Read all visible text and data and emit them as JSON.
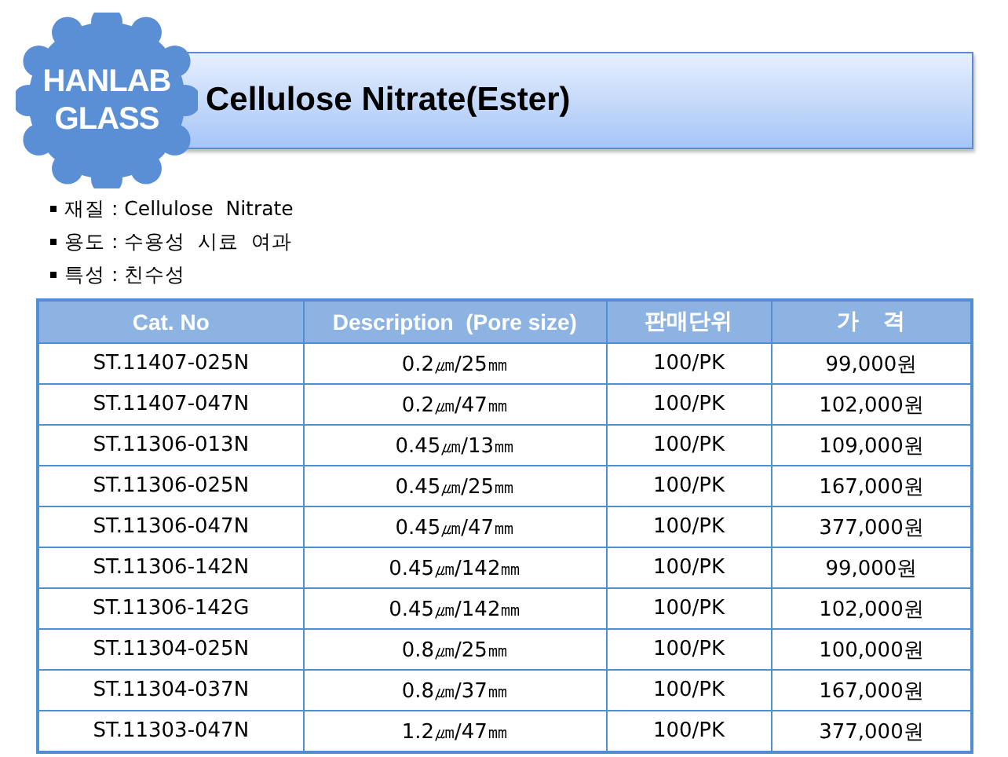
{
  "badge": {
    "lines": [
      "HANLAB",
      "GLASS"
    ]
  },
  "title": "Cellulose Nitrate(Ester)",
  "specs": [
    {
      "text": "재질 : Cellulose  Nitrate"
    },
    {
      "text": "용도 : 수용성  시료  여과"
    },
    {
      "text": "특성 : 친수성"
    }
  ],
  "table": {
    "columns": [
      "Cat. No",
      "Description  (Pore size)",
      "판매단위",
      "가    격"
    ],
    "rows": [
      [
        "ST.11407-025N",
        "0.2㎛/25㎜",
        "100/PK",
        "99,000원"
      ],
      [
        "ST.11407-047N",
        "0.2㎛/47㎜",
        "100/PK",
        "102,000원"
      ],
      [
        "ST.11306-013N",
        "0.45㎛/13㎜",
        "100/PK",
        "109,000원"
      ],
      [
        "ST.11306-025N",
        "0.45㎛/25㎜",
        "100/PK",
        "167,000원"
      ],
      [
        "ST.11306-047N",
        "0.45㎛/47㎜",
        "100/PK",
        "377,000원"
      ],
      [
        "ST.11306-142N",
        "0.45㎛/142㎜",
        "100/PK",
        "99,000원"
      ],
      [
        "ST.11306-142G",
        "0.45㎛/142㎜",
        "100/PK",
        "102,000원"
      ],
      [
        "ST.11304-025N",
        "0.8㎛/25㎜",
        "100/PK",
        "100,000원"
      ],
      [
        "ST.11304-037N",
        "0.8㎛/37㎜",
        "100/PK",
        "167,000원"
      ],
      [
        "ST.11303-047N",
        "1.2㎛/47㎜",
        "100/PK",
        "377,000원"
      ]
    ]
  }
}
